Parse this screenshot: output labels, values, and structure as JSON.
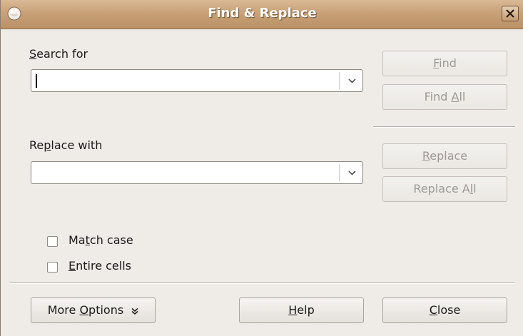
{
  "window": {
    "title": "Find & Replace"
  },
  "search": {
    "label_pre": "",
    "label_mn": "S",
    "label_post": "earch for",
    "value": ""
  },
  "replace": {
    "label_pre": "Re",
    "label_mn": "p",
    "label_post": "lace with",
    "value": ""
  },
  "buttons": {
    "find": {
      "pre": "",
      "mn": "F",
      "post": "ind",
      "enabled": false
    },
    "find_all": {
      "pre": "Find ",
      "mn": "A",
      "post": "ll",
      "enabled": false
    },
    "replace": {
      "pre": "",
      "mn": "R",
      "post": "eplace",
      "enabled": false
    },
    "replace_all": {
      "pre": "Replace A",
      "mn": "l",
      "post": "l",
      "enabled": false
    },
    "more_options": {
      "pre": "More ",
      "mn": "O",
      "post": "ptions",
      "icon": "double-chevron-down-icon"
    },
    "help": {
      "pre": "",
      "mn": "H",
      "post": "elp"
    },
    "close": {
      "pre": "",
      "mn": "C",
      "post": "lose"
    }
  },
  "options": {
    "match_case": {
      "pre": "Ma",
      "mn": "t",
      "post": "ch case",
      "checked": false
    },
    "entire_cells": {
      "pre": "",
      "mn": "E",
      "post": "ntire cells",
      "checked": false
    }
  },
  "icons": {
    "app": "app-icon",
    "close": "close-icon",
    "dropdown": "chevron-down-icon"
  },
  "colors": {
    "titlebar": "#c8a177",
    "dialog_bg": "#efebe7",
    "disabled_text": "#9d9a95"
  }
}
